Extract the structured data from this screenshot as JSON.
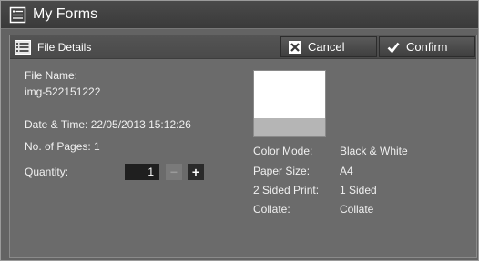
{
  "window": {
    "title": "My Forms",
    "title_icon": "document-icon"
  },
  "subheader": {
    "title": "File Details",
    "icon": "list-icon"
  },
  "buttons": {
    "cancel": "Cancel",
    "confirm": "Confirm"
  },
  "details": {
    "file_name_label": "File Name:",
    "file_name_value": "img-522151222",
    "datetime": "Date & Time: 22/05/2013 15:12:26",
    "pages": "No. of Pages: 1",
    "quantity_label": "Quantity:",
    "quantity_value": "1",
    "minus": "−",
    "plus": "+"
  },
  "settings": [
    {
      "label": "Color Mode:",
      "value": "Black & White"
    },
    {
      "label": "Paper Size:",
      "value": "A4"
    },
    {
      "label": "2 Sided Print:",
      "value": "1 Sided"
    },
    {
      "label": "Collate:",
      "value": "Collate"
    }
  ],
  "colors": {
    "background": "#636363",
    "panel": "#6b6b6b",
    "titlebar": "#3a3a3a",
    "text": "#ffffff"
  }
}
